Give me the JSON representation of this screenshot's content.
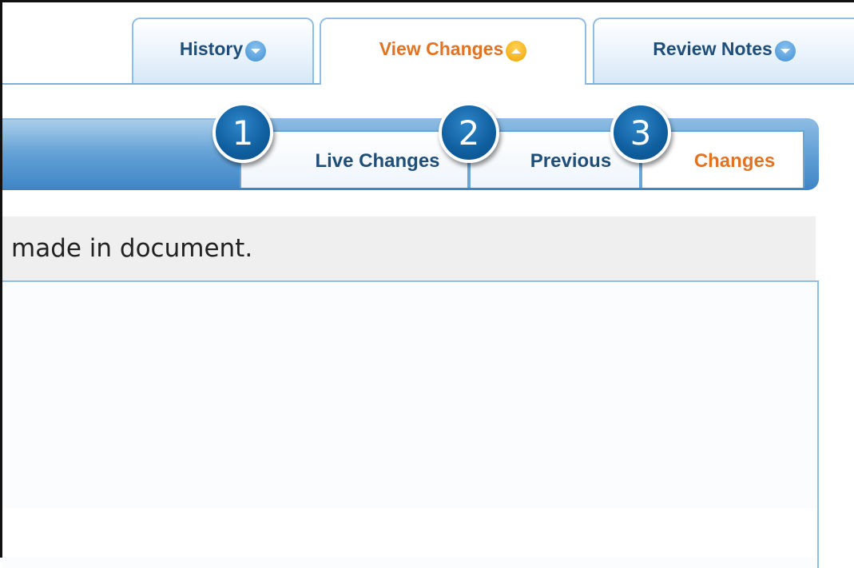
{
  "top_tabs": [
    {
      "label": "History",
      "icon": "chevron-down-icon",
      "active": false
    },
    {
      "label": "View Changes",
      "icon": "chevron-up-icon",
      "active": true
    },
    {
      "label": "Review Notes",
      "icon": "chevron-down-icon",
      "active": false
    }
  ],
  "sub_tabs": [
    {
      "label": "Live Changes",
      "callout": "1"
    },
    {
      "label": "Previous",
      "callout": "2"
    },
    {
      "label": "Changes",
      "callout": "3",
      "active": true
    }
  ],
  "message": "made in document.",
  "colors": {
    "active_tab_text": "#e07424",
    "tab_text": "#1f4e79",
    "band_blue": "#3e85c6",
    "badge_blue": "#0f5e9e",
    "message_bg": "#efefef"
  }
}
